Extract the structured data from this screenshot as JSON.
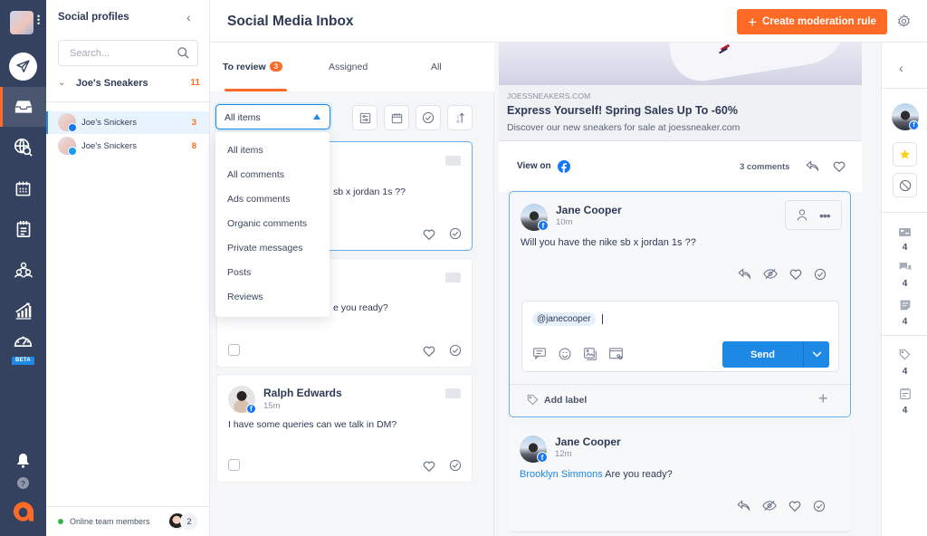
{
  "rail": {
    "nav": [
      {
        "icon": "compose-icon",
        "label": "Publish"
      },
      {
        "icon": "inbox-icon",
        "label": "Inbox",
        "active": true
      },
      {
        "icon": "globe-search-icon",
        "label": "Listening"
      },
      {
        "icon": "calendar-icon",
        "label": "Calendar"
      },
      {
        "icon": "notes-icon",
        "label": "Content"
      },
      {
        "icon": "team-icon",
        "label": "Team"
      },
      {
        "icon": "analytics-icon",
        "label": "Analytics"
      },
      {
        "icon": "gauge-icon",
        "label": "Performance",
        "badge": "BETA"
      }
    ],
    "beta_label": "BETA",
    "bottom": [
      {
        "icon": "bell-icon"
      },
      {
        "icon": "help-icon",
        "label": "?"
      }
    ],
    "brand_color": "#ff6b26"
  },
  "profiles": {
    "title": "Social profiles",
    "search_placeholder": "Search...",
    "group": {
      "name": "Joe's Sneakers",
      "count": "11"
    },
    "items": [
      {
        "name": "Joe's Snickers",
        "network": "facebook",
        "count": "3",
        "active": true
      },
      {
        "name": "Joe's Snickers",
        "network": "twitter",
        "count": "8",
        "active": false
      }
    ],
    "footer": {
      "label": "Online team members",
      "count": "2"
    }
  },
  "header": {
    "title": "Social Media Inbox",
    "create_button": "Create moderation rule",
    "accent": "#ff6b26"
  },
  "list": {
    "tabs": [
      {
        "label": "To review",
        "badge": "3",
        "active": true
      },
      {
        "label": "Assigned"
      },
      {
        "label": "All"
      }
    ],
    "filter": {
      "value": "All items",
      "options": [
        "All items",
        "All comments",
        "Ads comments",
        "Organic comments",
        "Private messages",
        "Posts",
        "Reviews"
      ]
    },
    "toolbar": [
      "filters-icon",
      "calendar-icon",
      "check-circle-icon",
      "sort-icon"
    ],
    "cards": [
      {
        "name": "Jane Cooper",
        "time": "10m",
        "message": "Will you have the nike sb x jordan 1s ??",
        "visible_fragment": "sb x jordan 1s ??",
        "selected": true
      },
      {
        "name": "Jane Cooper",
        "time": "12m",
        "message": "Brooklyn Simmons Are you ready?",
        "visible_fragment": "e you ready?"
      },
      {
        "name": "Ralph Edwards",
        "time": "15m",
        "message": "I have some queries can we talk in DM?"
      }
    ]
  },
  "detail": {
    "ad": {
      "domain": "JOESSNEAKERS.COM",
      "title": "Express Yourself! Spring Sales Up To -60%",
      "description": "Discover our new sneakers for sale at joessneaker.com"
    },
    "view_on": "View on",
    "comments_count": "3 comments",
    "comments": [
      {
        "name": "Jane Cooper",
        "time": "10m",
        "message": "Will you have the nike sb x jordan 1s ??",
        "selected": true
      },
      {
        "name": "Jane Cooper",
        "time": "12m",
        "mention": "Brooklyn Simmons",
        "message": "Are you ready?"
      }
    ],
    "reply": {
      "mention": "@janecooper",
      "send_label": "Send"
    },
    "add_label": "Add label",
    "send_color": "#1e88e5"
  },
  "rrail": {
    "stats": [
      {
        "icon": "ads-icon",
        "count": "4"
      },
      {
        "icon": "comments-icon",
        "count": "4"
      },
      {
        "icon": "post-icon",
        "count": "4"
      },
      {
        "icon": "tag-icon",
        "count": "4"
      },
      {
        "icon": "notes-icon",
        "count": "4"
      }
    ]
  }
}
